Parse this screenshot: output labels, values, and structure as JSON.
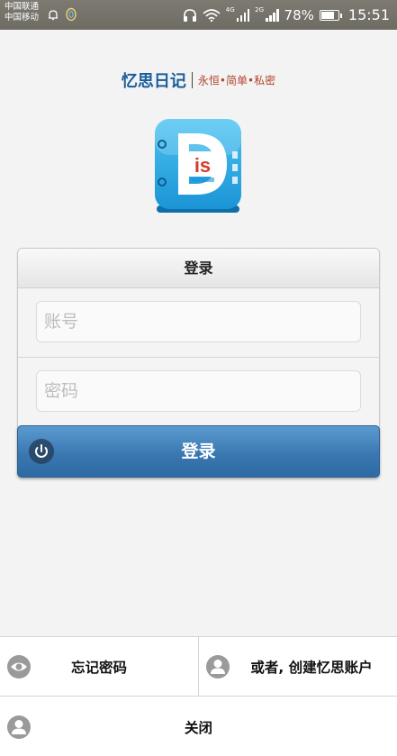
{
  "status_bar": {
    "carrier_1": "中国联通",
    "carrier_2": "中国移动",
    "net_1": "4G",
    "net_2": "2G",
    "battery": "78%",
    "time": "15:51"
  },
  "header": {
    "app_name": "忆思日记",
    "slogan": "永恒•简单•私密"
  },
  "login": {
    "title": "登录",
    "account_placeholder": "账号",
    "password_placeholder": "密码",
    "submit_label": "登录"
  },
  "sheet": {
    "forgot_label": "忘记密码",
    "create_label": "或者, 创建忆思账户",
    "close_label": "关闭"
  },
  "colors": {
    "brand": "#1a5d9b",
    "slogan": "#b2452b",
    "login_button": "#3b78b2",
    "icon_blue": "#29aee6"
  },
  "icons": [
    "headphones-icon",
    "wifi-icon",
    "signal-icon",
    "battery-icon",
    "power-icon",
    "eye-icon",
    "user-icon"
  ]
}
